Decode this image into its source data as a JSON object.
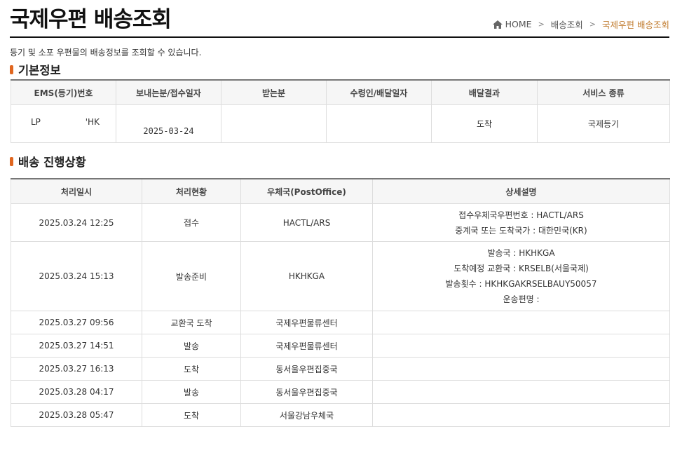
{
  "page": {
    "title": "국제우편 배송조회",
    "intro": "등기 및 소포 우편물의 배송정보를 조회할 수 있습니다."
  },
  "breadcrumb": {
    "home": "HOME",
    "level1": "배송조회",
    "current": "국제우편 배송조회",
    "separator": ">"
  },
  "basic_info": {
    "heading": "기본정보",
    "headers": [
      "EMS(등기)번호",
      "보내는분/접수일자",
      "받는분",
      "수령인/배달일자",
      "배달결과",
      "서비스 종류"
    ],
    "row": {
      "ems_prefix": "LP",
      "ems_suffix": "'HK",
      "sender": "",
      "date": "2025-03-24",
      "recipient": "",
      "receiver_date": "",
      "result": "도착",
      "service": "국제등기"
    }
  },
  "progress": {
    "heading": "배송 진행상황",
    "headers": [
      "처리일시",
      "처리현황",
      "우체국(PostOffice)",
      "상세설명"
    ],
    "rows": [
      {
        "datetime": "2025.03.24 12:25",
        "status": "접수",
        "office": "HACTL/ARS",
        "details": [
          "접수우체국우편번호 : HACTL/ARS",
          "중계국 또는 도착국가 : 대한민국(KR)"
        ]
      },
      {
        "datetime": "2025.03.24 15:13",
        "status": "발송준비",
        "office": "HKHKGA",
        "details": [
          "발송국 : HKHKGA",
          "도착예정 교환국 : KRSELB(서울국제)",
          "발송횟수 : HKHKGAKRSELBAUY50057",
          "운송편명 :"
        ]
      },
      {
        "datetime": "2025.03.27 09:56",
        "status": "교환국 도착",
        "office": "국제우편물류센터",
        "details": []
      },
      {
        "datetime": "2025.03.27 14:51",
        "status": "발송",
        "office": "국제우편물류센터",
        "details": []
      },
      {
        "datetime": "2025.03.27 16:13",
        "status": "도착",
        "office": "동서울우편집중국",
        "details": []
      },
      {
        "datetime": "2025.03.28 04:17",
        "status": "발송",
        "office": "동서울우편집중국",
        "details": []
      },
      {
        "datetime": "2025.03.28 05:47",
        "status": "도착",
        "office": "서울강남우체국",
        "details": []
      }
    ]
  },
  "icons": {
    "home": "home-icon",
    "separator": "chevron-right-icon"
  },
  "colors": {
    "accent": "#e0661f",
    "breadcrumb_current": "#c07a2c",
    "title": "#111111"
  }
}
